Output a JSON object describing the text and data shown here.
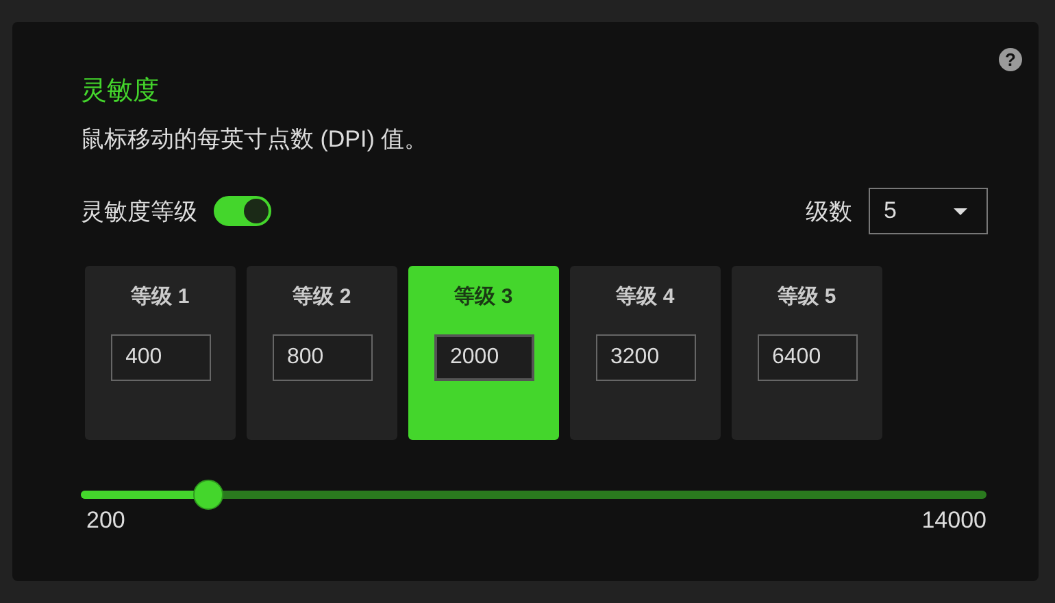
{
  "title": "灵敏度",
  "description": "鼠标移动的每英寸点数 (DPI) 值。",
  "help_icon": "?",
  "sensitivity_levels": {
    "label": "灵敏度等级",
    "on": true
  },
  "level_count": {
    "label": "级数",
    "value": "5"
  },
  "levels": [
    {
      "label": "等级 1",
      "value": "400",
      "selected": false
    },
    {
      "label": "等级 2",
      "value": "800",
      "selected": false
    },
    {
      "label": "等级 3",
      "value": "2000",
      "selected": true
    },
    {
      "label": "等级 4",
      "value": "3200",
      "selected": false
    },
    {
      "label": "等级 5",
      "value": "6400",
      "selected": false
    }
  ],
  "slider": {
    "level": 0.14,
    "min_label": "200",
    "max_label": "14000"
  }
}
